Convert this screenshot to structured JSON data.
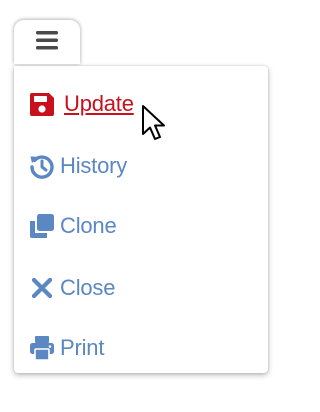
{
  "menu_toggle": {
    "icon": "hamburger-icon"
  },
  "menu": {
    "items": [
      {
        "label": "Update",
        "icon": "save-icon",
        "color": "#c8111c",
        "active": true
      },
      {
        "label": "History",
        "icon": "history-icon",
        "color": "#5b87c3",
        "active": false
      },
      {
        "label": "Clone",
        "icon": "clone-icon",
        "color": "#5b87c3",
        "active": false
      },
      {
        "label": "Close",
        "icon": "close-icon",
        "color": "#5b87c3",
        "active": false
      },
      {
        "label": "Print",
        "icon": "print-icon",
        "color": "#5b87c3",
        "active": false
      }
    ]
  },
  "colors": {
    "accent": "#5b87c3",
    "active": "#c8111c",
    "toggle_icon": "#4a4a4a"
  }
}
